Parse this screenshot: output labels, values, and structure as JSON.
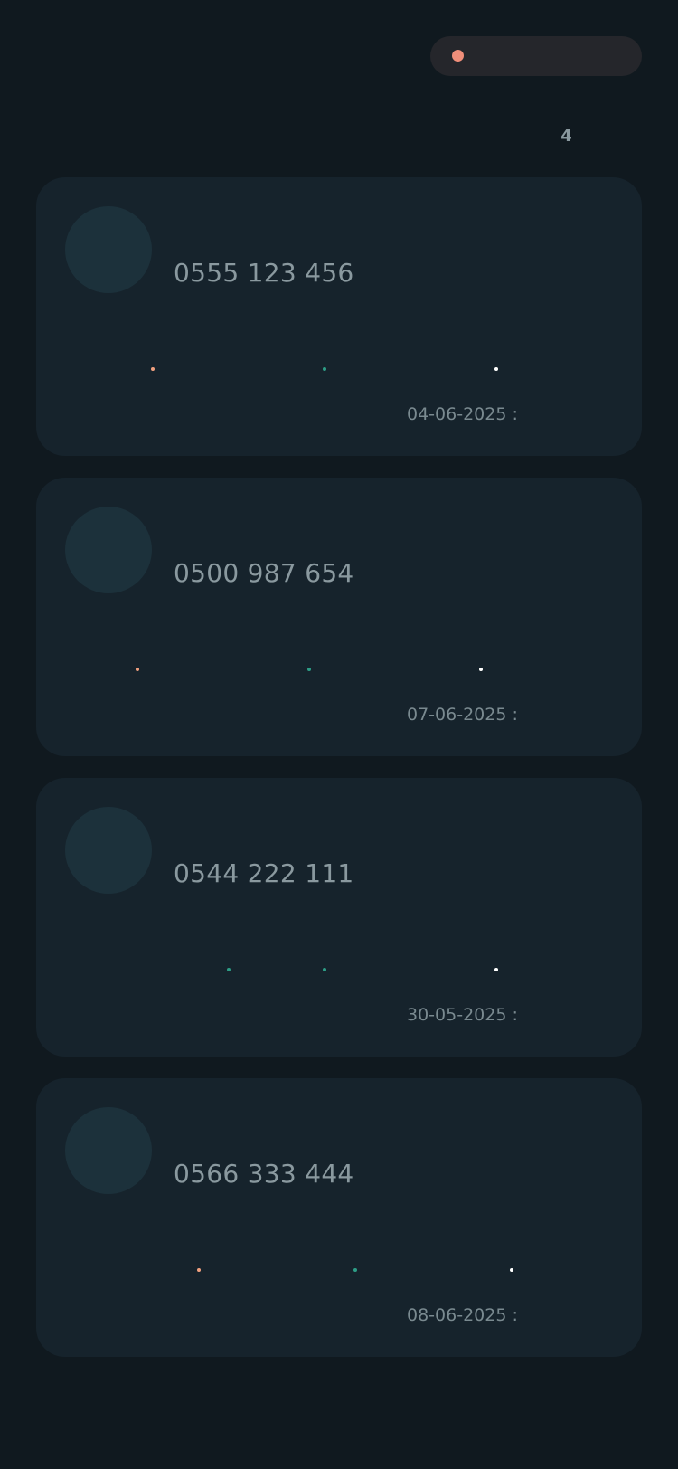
{
  "header": {
    "status_dot_color": "#f08e7a",
    "count": "4"
  },
  "colors": {
    "orange": "#f0a07f",
    "green": "#2d9d86",
    "white": "#ffffff"
  },
  "cards": [
    {
      "phone": "0555 123 456",
      "date": "04-06-2025 :"
    },
    {
      "phone": "0500 987 654",
      "date": "07-06-2025 :"
    },
    {
      "phone": "0544 222 111",
      "date": "30-05-2025 :"
    },
    {
      "phone": "0566 333 444",
      "date": "08-06-2025 :"
    }
  ]
}
